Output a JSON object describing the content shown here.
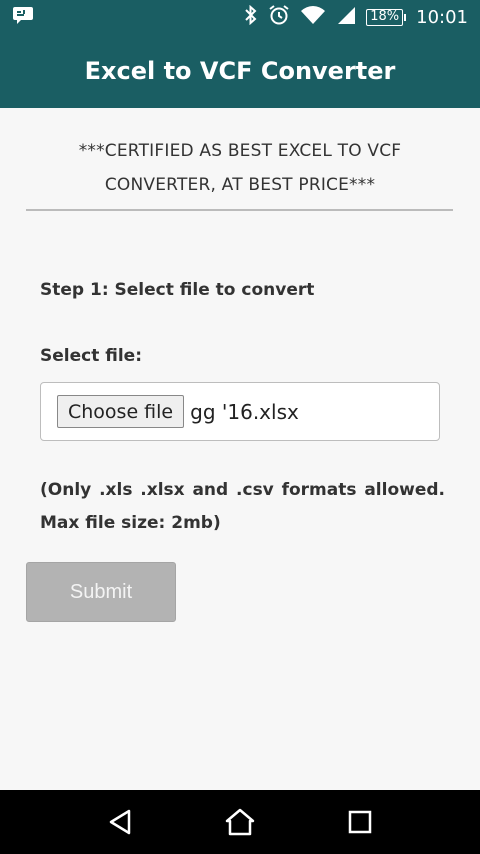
{
  "status_bar": {
    "battery": "18%",
    "time": "10:01",
    "icons": [
      "notification-icon",
      "bluetooth-icon",
      "alarm-icon",
      "wifi-icon",
      "signal-icon",
      "battery-icon"
    ]
  },
  "app_bar": {
    "title": "Excel to VCF Converter"
  },
  "main": {
    "certified_line1": "***CERTIFIED AS BEST EXCEL TO VCF",
    "certified_line2": "CONVERTER, AT BEST PRICE***",
    "step_label": "Step 1: Select file to convert",
    "select_label": "Select file:",
    "choose_file_label": "Choose file",
    "file_name": "gg '16.xlsx",
    "formats_line1": "(Only .xls .xlsx and .csv formats allowed.",
    "formats_line2": "Max file size: 2mb)",
    "submit_label": "Submit"
  },
  "nav_bar": {
    "icons": [
      "back-icon",
      "home-icon",
      "recents-icon"
    ]
  },
  "colors": {
    "header": "#1a5e63",
    "background": "#f7f7f7",
    "submit_disabled": "#b3b3b3"
  }
}
